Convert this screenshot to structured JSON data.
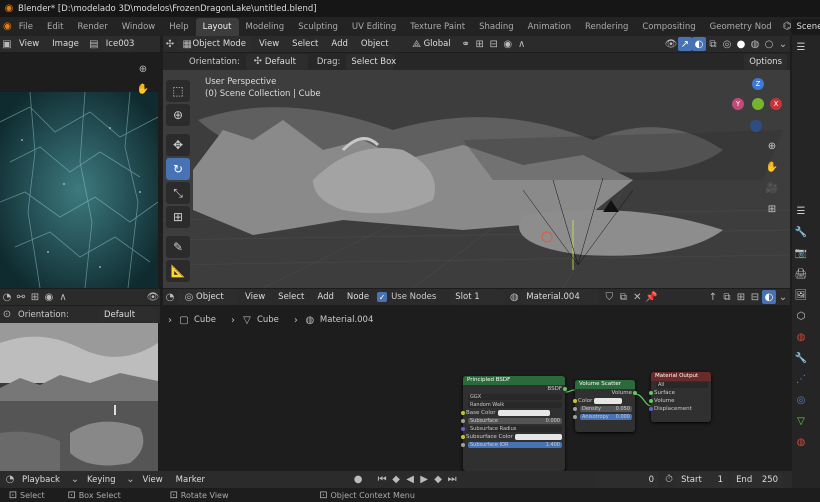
{
  "window": {
    "title": "Blender* [D:\\modelado 3D\\modelos\\FrozenDragonLake\\untitled.blend]"
  },
  "topbar": {
    "menus": [
      "File",
      "Edit",
      "Render",
      "Window",
      "Help"
    ],
    "workspaces": [
      "Layout",
      "Modeling",
      "Sculpting",
      "UV Editing",
      "Texture Paint",
      "Shading",
      "Animation",
      "Rendering",
      "Compositing",
      "Geometry Nod"
    ],
    "scene": "Scene"
  },
  "image_editor": {
    "view": "View",
    "image": "Image",
    "image_name": "Ice003"
  },
  "viewport_header": {
    "mode": "Object Mode",
    "menus": [
      "View",
      "Select",
      "Add",
      "Object"
    ],
    "transform": "Global"
  },
  "viewport_sub": {
    "orientation_label": "Orientation:",
    "orientation": "Default",
    "drag_label": "Drag:",
    "drag": "Select Box",
    "options": "Options"
  },
  "viewport_overlay": {
    "line1": "User Perspective",
    "line2": "(0) Scene Collection | Cube"
  },
  "gizmo": {
    "z": "Z",
    "y": "Y",
    "x": "X"
  },
  "left_bottom": {
    "orientation_label": "Orientation:",
    "orientation": "Default"
  },
  "node_header": {
    "type": "Object",
    "menus": [
      "View",
      "Select",
      "Add",
      "Node"
    ],
    "use_nodes": "Use Nodes",
    "slot": "Slot 1",
    "material": "Material.004"
  },
  "breadcrumb": {
    "a": "Cube",
    "b": "Cube",
    "c": "Material.004"
  },
  "nodes": {
    "bsdf": {
      "title": "Principled BSDF",
      "out": "BSDF",
      "dist": "GGX",
      "sss": "Random Walk",
      "base_color": "Base Color",
      "subsurface": "Subsurface",
      "subsurface_val": "0.000",
      "ss_radius": "Subsurface Radius",
      "ss_color": "Subsurface Color",
      "ss_ior": "Subsurface IOR",
      "ss_ior_val": "1.400"
    },
    "vol": {
      "title": "Volume Scatter",
      "out": "Volume",
      "color": "Color",
      "density": "Density",
      "density_val": "0.050",
      "aniso": "Anisotropy",
      "aniso_val": "0.000"
    },
    "out": {
      "title": "Material Output",
      "target": "All",
      "surface": "Surface",
      "volume": "Volume",
      "displacement": "Displacement"
    }
  },
  "timeline": {
    "menus": [
      "Playback",
      "Keying",
      "View",
      "Marker"
    ],
    "frame": "0",
    "start_label": "Start",
    "start": "1",
    "end_label": "End",
    "end": "250"
  },
  "status": {
    "select": "Select",
    "box_select": "Box Select",
    "rotate": "Rotate View",
    "context": "Object Context Menu"
  },
  "colors": {
    "accent": "#4772b3",
    "bsdf_header": "#2b6a3a",
    "vol_header": "#2b6a3a",
    "out_header": "#6b2a2a"
  }
}
